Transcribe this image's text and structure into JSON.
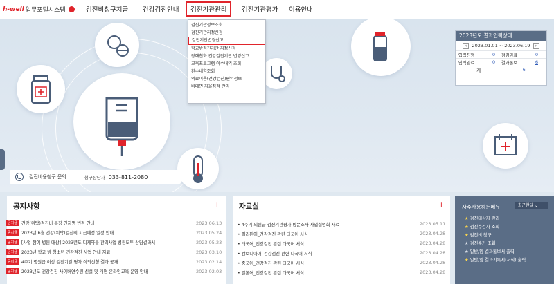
{
  "header": {
    "logo_brand": "h-well",
    "logo_title": "업무포털시스템",
    "menu": [
      "검진비청구지급",
      "건강검진안내",
      "검진기관관리",
      "검진기관평가",
      "이용안내"
    ]
  },
  "dropdown": {
    "items": [
      "검진기관정보조회",
      "검진기관지정신청",
      "검진기관변경신고",
      "학교밖검진기관 지정신청",
      "장애친화 건강검진기관 변경신고",
      "교육프로그램 이수내역 조회",
      "환수내역조회",
      "의료이용(건강검진)편익정보",
      "비대면 자율점검 관리"
    ]
  },
  "status": {
    "title": "2023년도 결과입력상태",
    "date_range": "2023.01.01 ~ 2023.06.19",
    "rows": [
      {
        "l1": "입력진행",
        "v1": "0",
        "l2": "점검완료",
        "v2": "0"
      },
      {
        "l1": "입력완료",
        "v1": "0",
        "l2": "결과통보",
        "v2": "6"
      }
    ],
    "total_label": "계",
    "total_value": "6"
  },
  "contact": {
    "title": "검진비용청구 문의",
    "sub": "청구상담사",
    "number": "033-811-2080"
  },
  "notice": {
    "title": "공지사항",
    "plus": "+",
    "badge": "공지글",
    "items": [
      {
        "text": "건강(위탁)검진비 통장 인자명 변경 안내",
        "date": "2023.06.13"
      },
      {
        "text": "2023년 6월 건강(위탁)검진비 지급예정 일정 안내",
        "date": "2023.05.24"
      },
      {
        "text": "[사업 참여 병원 대상] 2023년도 디제약물 관리사업 병원모투 상담결과서 작성방...",
        "date": "2023.05.23"
      },
      {
        "text": "2023년 학교 밖 청소년 건강검진 사업 안내 자료",
        "date": "2023.03.10"
      },
      {
        "text": "4주기 병원급 이상 검진기관 평가 이의신청 결과 공개",
        "date": "2023.02.14"
      },
      {
        "text": "2023년도 건강검진 사이버연수원 신설 및 개편 온라인교육 운영 안내",
        "date": "2023.02.03"
      }
    ]
  },
  "data": {
    "title": "자료실",
    "plus": "+",
    "items": [
      {
        "text": "4주기 의원급 검진기관평가 방문조사 사업설명회 자료",
        "date": "2023.05.11"
      },
      {
        "text": "필리핀어_건강검진 관련 다국어 서식",
        "date": "2023.04.28"
      },
      {
        "text": "태국어_건강검진 관련 다국어 서식",
        "date": "2023.04.28"
      },
      {
        "text": "캄보디아어_건강검진 관련 다국어 서식",
        "date": "2023.04.28"
      },
      {
        "text": "중국어_건강검진 관련 다국어 서식",
        "date": "2023.04.28"
      },
      {
        "text": "일본어_건강검진 관련 다국어 서식",
        "date": "2023.04.28"
      }
    ]
  },
  "quick": {
    "title": "자주사용하는메뉴",
    "select": "최근한달",
    "items": [
      {
        "text": "검진대상자 관리",
        "icon": "star"
      },
      {
        "text": "검진수검자 조회",
        "icon": "star"
      },
      {
        "text": "검진비 청구",
        "icon": "star"
      },
      {
        "text": "검진수가 조회",
        "icon": "dot"
      },
      {
        "text": "일반/암 결과통보서 출력",
        "icon": "dot"
      },
      {
        "text": "일반/암 결과기록지(서식) 출력",
        "icon": "star"
      }
    ]
  }
}
